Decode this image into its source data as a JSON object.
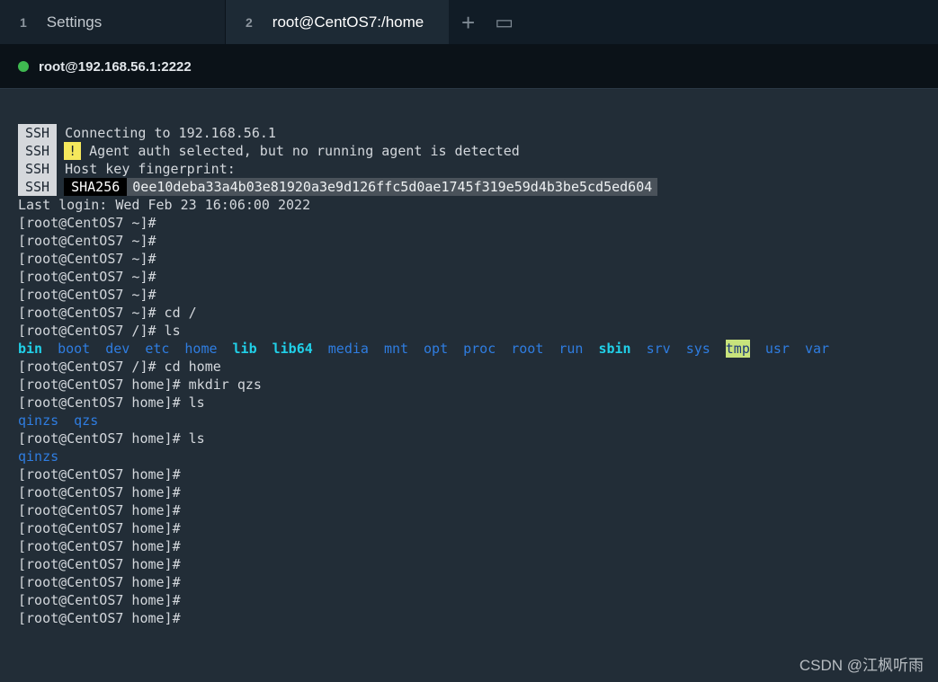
{
  "tabs": [
    {
      "num": "1",
      "label": "Settings"
    },
    {
      "num": "2",
      "label": "root@CentOS7:/home"
    }
  ],
  "tab_actions": {
    "new_tab": "+",
    "split": "▭"
  },
  "host": {
    "label": "root@192.168.56.1:2222",
    "status_color": "#3fb950"
  },
  "ssh": {
    "tag": "SSH",
    "connecting": "Connecting to 192.168.56.1",
    "warn_icon": "!",
    "agent_msg": "Agent auth selected, but no running agent is detected",
    "fingerprint_label": "Host key fingerprint:",
    "sha_label": "SHA256",
    "fingerprint": "0ee10deba33a4b03e81920a3e9d126ffc5d0ae1745f319e59d4b3be5cd5ed604"
  },
  "lines": {
    "last_login": "Last login: Wed Feb 23 16:06:00 2022",
    "p_root_1": "[root@CentOS7 ~]#",
    "p_root_2": "[root@CentOS7 ~]#",
    "p_root_3": "[root@CentOS7 ~]#",
    "p_root_4": "[root@CentOS7 ~]#",
    "p_root_5": "[root@CentOS7 ~]#",
    "cd_root": "[root@CentOS7 ~]# cd /",
    "ls_root": "[root@CentOS7 /]# ls",
    "cd_home": "[root@CentOS7 /]# cd home",
    "mkdir": "[root@CentOS7 home]# mkdir qzs",
    "ls_home_1": "[root@CentOS7 home]# ls",
    "ls_home_2": "[root@CentOS7 home]# ls",
    "p_home_1": "[root@CentOS7 home]#",
    "p_home_2": "[root@CentOS7 home]#",
    "p_home_3": "[root@CentOS7 home]#",
    "p_home_4": "[root@CentOS7 home]#",
    "p_home_5": "[root@CentOS7 home]#",
    "p_home_6": "[root@CentOS7 home]#",
    "p_home_7": "[root@CentOS7 home]#",
    "p_home_8": "[root@CentOS7 home]#",
    "p_home_9": "[root@CentOS7 home]#"
  },
  "ls_root_out": [
    "bin",
    "boot",
    "dev",
    "etc",
    "home",
    "lib",
    "lib64",
    "media",
    "mnt",
    "opt",
    "proc",
    "root",
    "run",
    "sbin",
    "srv",
    "sys",
    "tmp",
    "usr",
    "var"
  ],
  "ls_home_out_1": [
    "qinzs",
    "qzs"
  ],
  "ls_home_out_2": [
    "qinzs"
  ],
  "watermark": "CSDN @江枫听雨"
}
